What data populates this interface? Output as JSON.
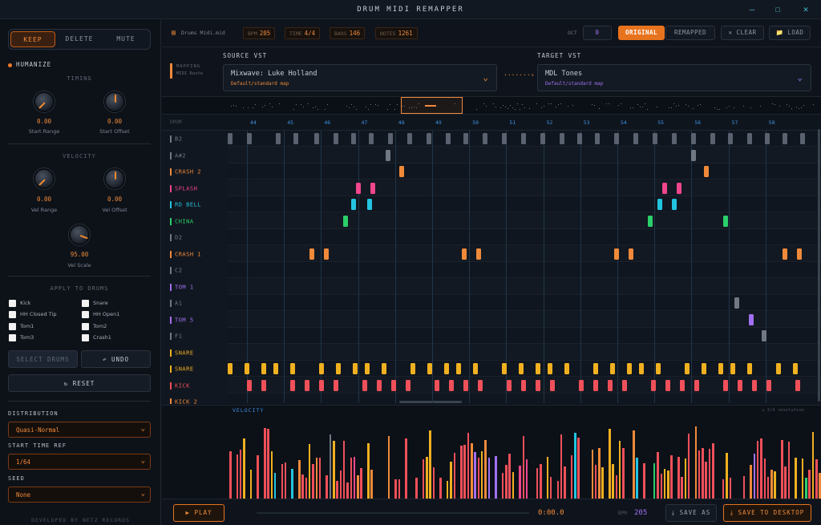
{
  "window": {
    "title": "DRUM MIDI REMAPPER",
    "minimize": "–",
    "maximize": "☐",
    "close": "✕"
  },
  "modes": [
    {
      "label": "KEEP",
      "active": true
    },
    {
      "label": "DELETE"
    },
    {
      "label": "MUTE"
    }
  ],
  "humanize": {
    "label": "HUMANIZE",
    "timing_label": "TIMING",
    "velocity_label": "VELOCITY",
    "knobs": [
      {
        "value": "0.00",
        "label": "Start Range"
      },
      {
        "value": "0.00",
        "label": "Start Offset"
      },
      {
        "value": "0.00",
        "label": "Vel Range"
      },
      {
        "value": "0.00",
        "label": "Vel Offset"
      },
      {
        "value": "95.00",
        "label": "Vel Scale"
      }
    ]
  },
  "apply": {
    "label": "APPLY TO DRUMS",
    "drums": [
      "Kick",
      "Snare",
      "HH Closed Tip",
      "HH Open1",
      "Tom1",
      "Tom2",
      "Tom3",
      "Crash1"
    ],
    "select_label": "SELECT DRUMS",
    "undo_label": "↶ UNDO",
    "reset_label": "↻ RESET"
  },
  "fields": [
    {
      "label": "DISTRIBUTION",
      "value": "Quasi-Normal"
    },
    {
      "label": "START TIME REF",
      "value": "1/64"
    },
    {
      "label": "SEED",
      "value": "None"
    }
  ],
  "footer": "DEVELOPED BY NETZ RECORDS",
  "toolbar": {
    "file": "Drums Midi.mid",
    "bpm_label": "BPM",
    "bpm": "205",
    "time_label": "TIME",
    "time": "4/4",
    "bars_label": "BARS",
    "bars": "146",
    "notes_label": "NOTES",
    "notes": "1261",
    "oct_label": "OCT",
    "oct": "0",
    "original": "ORIGINAL",
    "remapped": "REMAPPED",
    "clear": "✕ CLEAR",
    "load": "📁 LOAD"
  },
  "mapping": {
    "line1": "MAPPING",
    "line2": "MIDI Route"
  },
  "source": {
    "label": "SOURCE VST",
    "name": "Mixwave: Luke Holland",
    "sub": "Default/standard map"
  },
  "target": {
    "label": "TARGET VST",
    "name": "MDL Tones",
    "sub": "Default/standard map"
  },
  "grid": {
    "header": "DRUM",
    "bars": [
      "44",
      "45",
      "46",
      "47",
      "48",
      "49",
      "50",
      "51",
      "52",
      "53",
      "54",
      "55",
      "56",
      "57",
      "58"
    ],
    "rows": [
      {
        "name": "B2",
        "color": "#707884"
      },
      {
        "name": "A#2",
        "color": "#707884"
      },
      {
        "name": "CRASH 2",
        "color": "#f08a3a"
      },
      {
        "name": "SPLASH",
        "color": "#f0468c"
      },
      {
        "name": "RD BELL",
        "color": "#22c4e0"
      },
      {
        "name": "CHINA",
        "color": "#2bd06a"
      },
      {
        "name": "D2",
        "color": "#707884"
      },
      {
        "name": "CRASH 1",
        "color": "#f08a3a"
      },
      {
        "name": "C2",
        "color": "#707884"
      },
      {
        "name": "TOM 1",
        "color": "#a070f0"
      },
      {
        "name": "A1",
        "color": "#707884"
      },
      {
        "name": "TOM 5",
        "color": "#a070f0"
      },
      {
        "name": "F1",
        "color": "#707884"
      },
      {
        "name": "SNARE",
        "color": "#f0b020"
      },
      {
        "name": "SNARE",
        "color": "#f0b020"
      },
      {
        "name": "KICK",
        "color": "#f0505a"
      },
      {
        "name": "KICK 2",
        "color": "#f08a3a"
      }
    ]
  },
  "velocity": {
    "label": "VELOCITY",
    "hint": "⇲ 3/4 resolution"
  },
  "transport": {
    "play": "▶ PLAY",
    "time": "0:00.0",
    "bpm_label": "BPM",
    "bpm": "205",
    "save_as": "⤓ SAVE AS",
    "save_desktop": "⤓ SAVE TO DESKTOP"
  }
}
